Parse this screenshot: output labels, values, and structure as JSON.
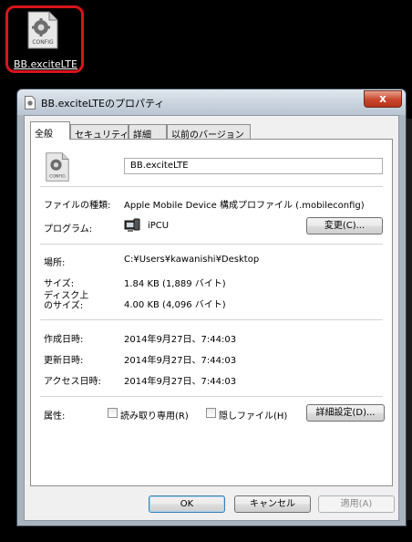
{
  "desktop": {
    "icon_caption": "BB.exciteLTE",
    "icon_badge": "CONFIG"
  },
  "window": {
    "title": "BB.exciteLTEのプロパティ",
    "close_label": "x",
    "tabs": [
      {
        "label": "全般",
        "active": true
      },
      {
        "label": "セキュリティ",
        "active": false
      },
      {
        "label": "詳細",
        "active": false
      },
      {
        "label": "以前のバージョン",
        "active": false
      }
    ]
  },
  "general": {
    "file_name": "BB.exciteLTE",
    "file_icon_badge": "CONFIG",
    "file_type_label": "ファイルの種類:",
    "file_type_value": "Apple Mobile Device 構成プロファイル (.mobileconfig)",
    "program_label": "プログラム:",
    "program_value": "iPCU",
    "change_button": "変更(C)...",
    "location_label": "場所:",
    "location_value": "C:¥Users¥kawanishi¥Desktop",
    "size_label": "サイズ:",
    "size_value": "1.84 KB (1,889 バイト)",
    "disk_size_label_1": "ディスク上",
    "disk_size_label_2": "のサイズ:",
    "disk_size_value": "4.00 KB (4,096 バイト)",
    "created_label": "作成日時:",
    "created_value": "2014年9月27日、7:44:03",
    "modified_label": "更新日時:",
    "modified_value": "2014年9月27日、7:44:03",
    "accessed_label": "アクセス日時:",
    "accessed_value": "2014年9月27日、7:44:03",
    "attributes_label": "属性:",
    "readonly_label": "読み取り専用(R)",
    "readonly_checked": false,
    "hidden_label": "隠しファイル(H)",
    "hidden_checked": false,
    "advanced_button": "詳細設定(D)..."
  },
  "footer": {
    "ok": "OK",
    "cancel": "キャンセル",
    "apply": "適用(A)"
  },
  "colors": {
    "highlight_ring": "#d8141c",
    "close_button": "#c8452b",
    "title_bar": "#c9d3de"
  }
}
